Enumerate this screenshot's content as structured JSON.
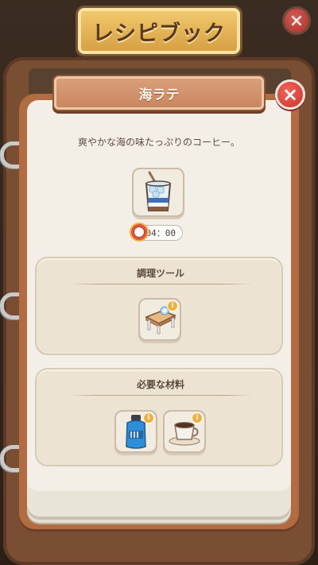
{
  "header": {
    "title": "レシピブック"
  },
  "modal": {
    "title": "海ラテ",
    "description": "爽やかな海の味たっぷりのコーヒー。",
    "timer": "04：00"
  },
  "tools_section": {
    "title": "調理ツール"
  },
  "ingredients_section": {
    "title": "必要な材料"
  },
  "icons": {
    "close": "×",
    "info": "i"
  },
  "colors": {
    "close_red": "#d2332d",
    "plaque_brown": "#c88660",
    "header_gold": "#e2ae52",
    "info_badge": "#f2b03a"
  }
}
